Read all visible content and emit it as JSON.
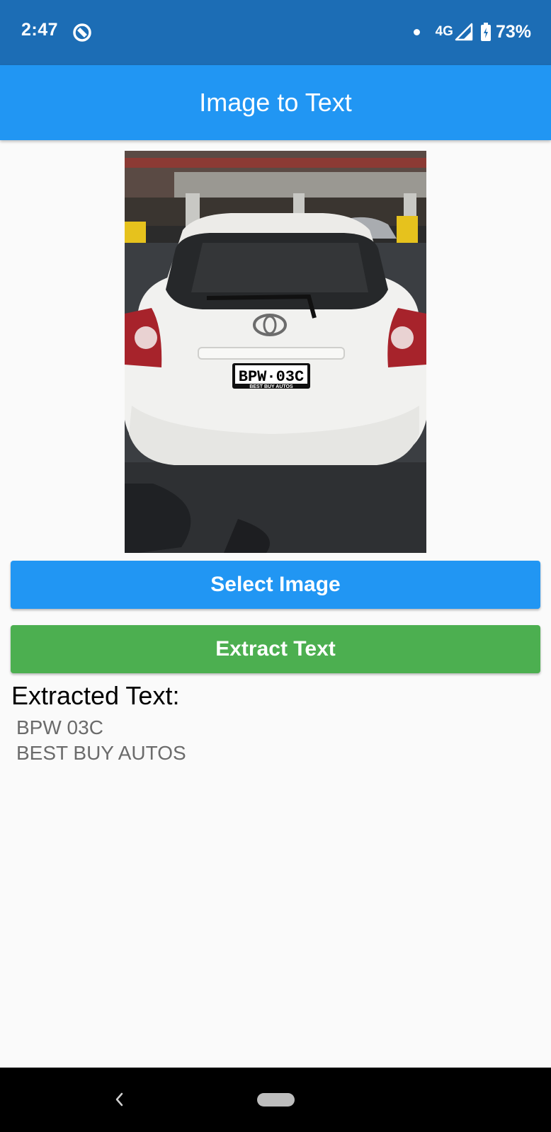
{
  "status_bar": {
    "time": "2:47",
    "network": "4G",
    "battery": "73%",
    "icons": [
      "app-notification-icon",
      "dot-icon",
      "signal-icon",
      "battery-charging-icon"
    ]
  },
  "app_bar": {
    "title": "Image to Text"
  },
  "photo": {
    "icon": "selected-car-photo",
    "plate_text": "BPW·03C",
    "dealer_text": "BEST BUY AUTOS"
  },
  "buttons": {
    "select_label": "Select Image",
    "extract_label": "Extract Text",
    "select_color": "#2196f3",
    "extract_color": "#4caf50"
  },
  "result": {
    "heading": "Extracted Text:",
    "lines": [
      "BPW 03C",
      "BEST BUY AUTOS"
    ]
  },
  "nav_bar": {
    "icons": [
      "back-icon",
      "home-pill-icon"
    ]
  },
  "colors": {
    "status_bar": "#1c6db5",
    "app_bar": "#2196f3",
    "background": "#fafafa"
  }
}
